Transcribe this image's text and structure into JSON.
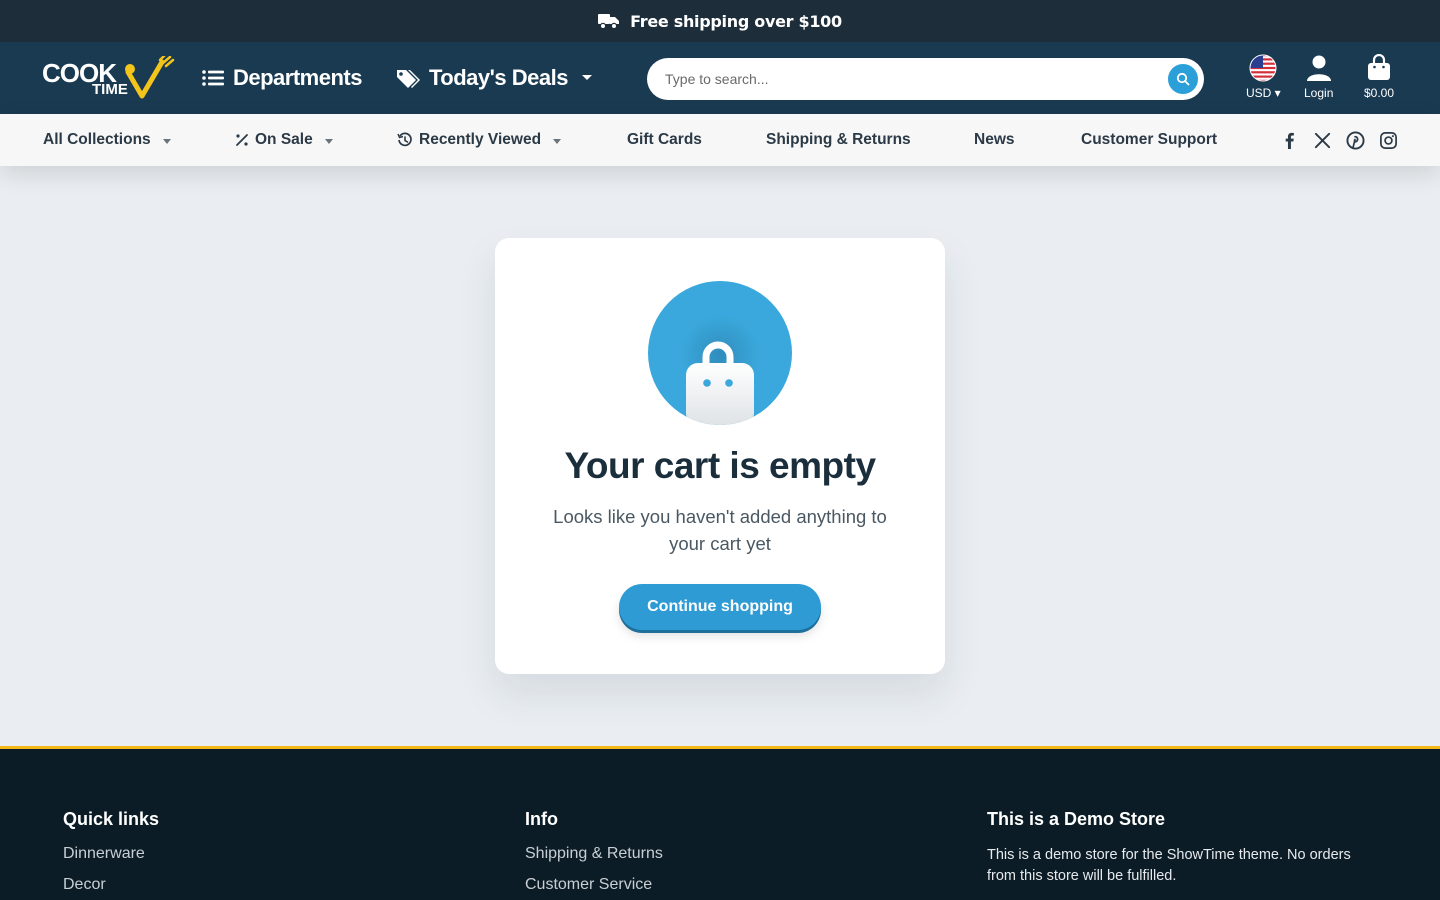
{
  "announcement": {
    "text": "Free shipping over $100"
  },
  "header": {
    "logo": {
      "line1": "COOK",
      "line2": "TIME"
    },
    "departments_label": "Departments",
    "deals_label": "Today's Deals",
    "search": {
      "placeholder": "Type to search..."
    },
    "currency": "USD",
    "login_label": "Login",
    "cart_total": "$0.00"
  },
  "subnav": {
    "items": [
      {
        "label": "All Collections"
      },
      {
        "label": "On Sale"
      },
      {
        "label": "Recently Viewed"
      },
      {
        "label": "Gift Cards"
      },
      {
        "label": "Shipping & Returns"
      },
      {
        "label": "News"
      },
      {
        "label": "Customer Support"
      }
    ]
  },
  "cart": {
    "title": "Your cart is empty",
    "message": "Looks like you haven't added anything to your cart yet",
    "button_label": "Continue shopping"
  },
  "footer": {
    "quick_links": {
      "heading": "Quick links",
      "links": [
        "Dinnerware",
        "Decor"
      ]
    },
    "info": {
      "heading": "Info",
      "links": [
        "Shipping & Returns",
        "Customer Service"
      ]
    },
    "demo": {
      "heading": "This is a Demo Store",
      "text": "This is a demo store for the ShowTime theme. No orders from this store will be fulfilled."
    }
  },
  "colors": {
    "accent": "#2b9fd8",
    "header_bg": "#1a3a52",
    "footer_bg": "#0c1c26",
    "footer_border": "#f3b71a"
  }
}
